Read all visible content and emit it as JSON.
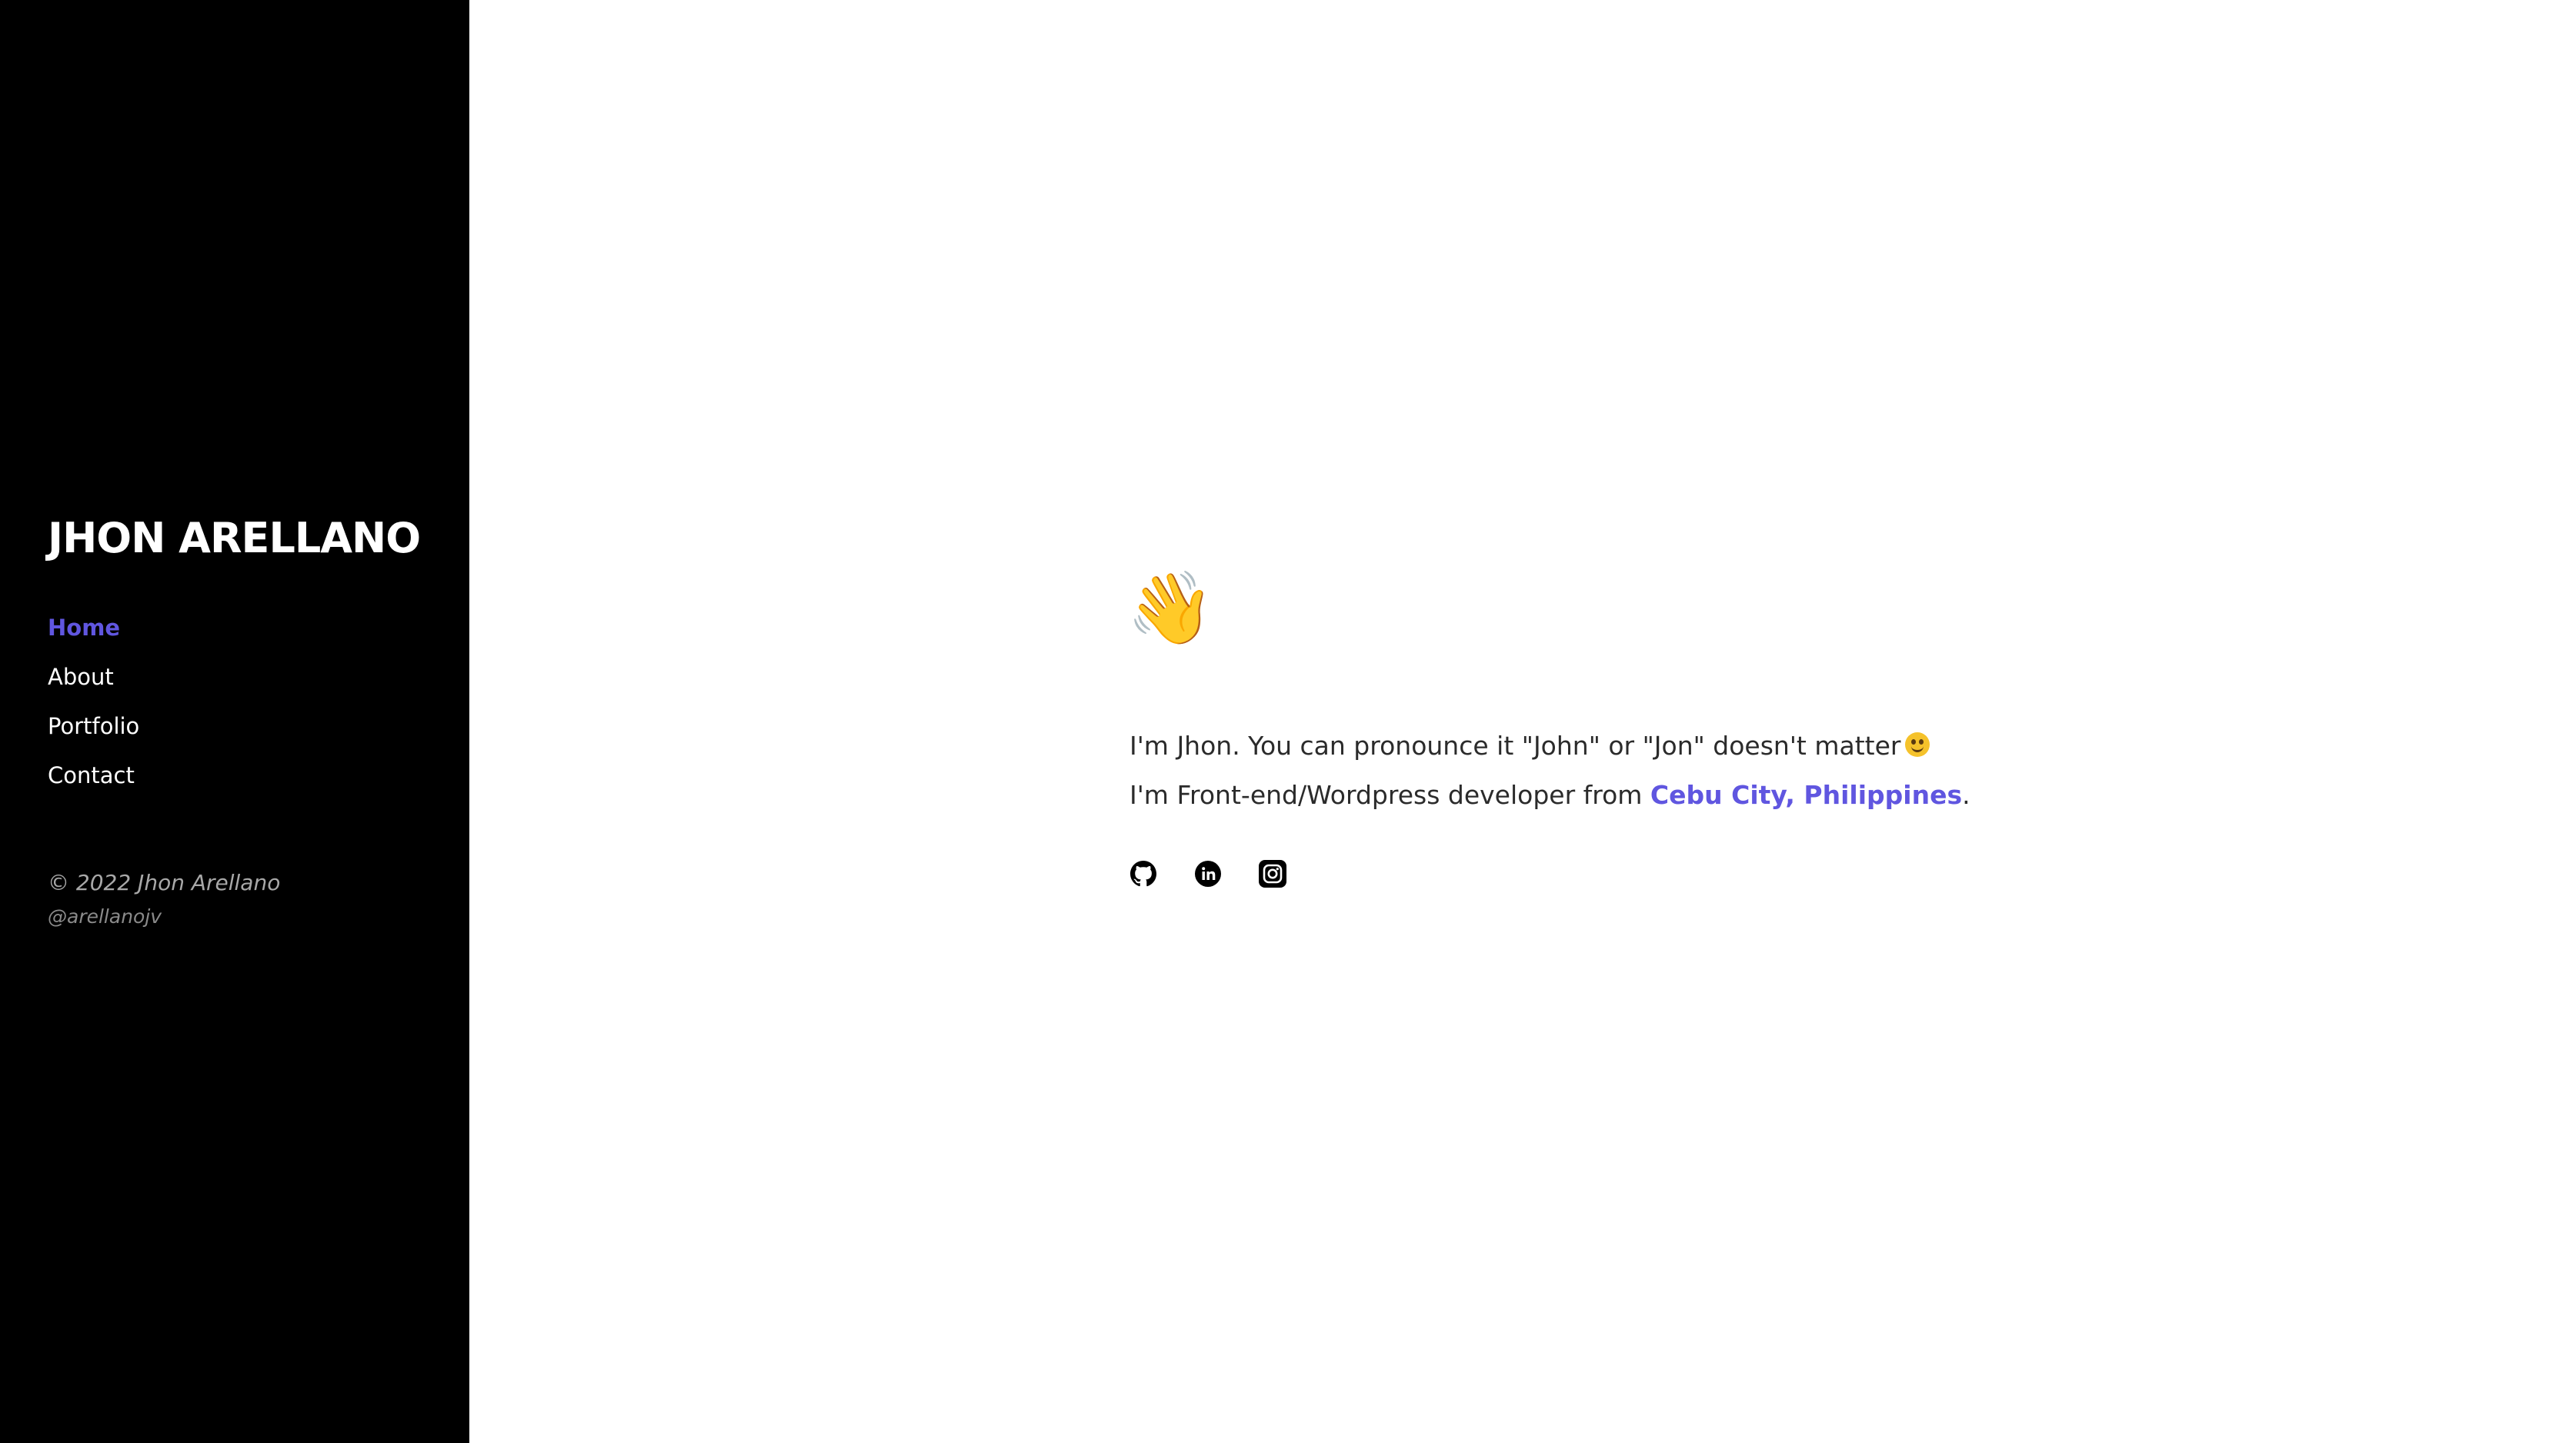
{
  "sidebar": {
    "brand": "JHON ARELLANO",
    "nav": [
      {
        "label": "Home",
        "active": true
      },
      {
        "label": "About",
        "active": false
      },
      {
        "label": "Portfolio",
        "active": false
      },
      {
        "label": "Contact",
        "active": false
      }
    ],
    "copyright": "© 2022 Jhon Arellano",
    "handle": "@arellanojv"
  },
  "main": {
    "greeting_emoji": "👋",
    "line1": "I'm Jhon. You can pronounce it \"John\" or \"Jon\" doesn't matter",
    "line1_emoji": "smiling-face-icon",
    "line2_prefix": "I'm Front-end/Wordpress developer from ",
    "location": "Cebu City, Philippines",
    "line2_suffix": ".",
    "socials": [
      {
        "icon": "github-icon"
      },
      {
        "icon": "linkedin-icon"
      },
      {
        "icon": "instagram-icon"
      }
    ]
  },
  "colors": {
    "accent": "#6056e0",
    "sidebar_bg": "#000000",
    "text": "#2b2b2b"
  }
}
